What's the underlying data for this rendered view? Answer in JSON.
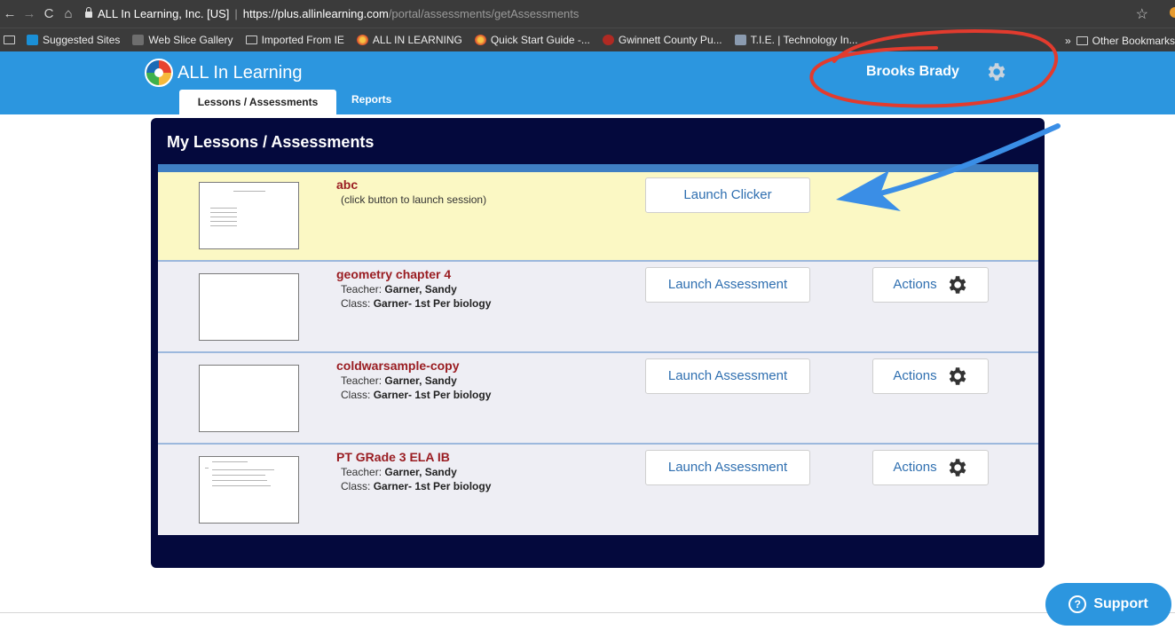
{
  "browser": {
    "site_identity": "ALL In Learning, Inc. [US]",
    "url_host": "https://plus.allinlearning.com",
    "url_path": "/portal/assessments/getAssessments",
    "bookmarks": [
      {
        "label": "Suggested Sites",
        "icon": "bing-icon"
      },
      {
        "label": "Web Slice Gallery",
        "icon": "web-slice-icon"
      },
      {
        "label": "Imported From IE",
        "icon": "folder-icon"
      },
      {
        "label": "ALL IN LEARNING",
        "icon": "all-in-learning-icon"
      },
      {
        "label": "Quick Start Guide -...",
        "icon": "all-in-learning-icon"
      },
      {
        "label": "Gwinnett County Pu...",
        "icon": "gwinnett-icon"
      },
      {
        "label": "T.I.E. | Technology In...",
        "icon": "tie-icon"
      }
    ],
    "overflow_label": "»",
    "other_bookmarks": "Other Bookmarks"
  },
  "header": {
    "brand": "ALL In Learning",
    "user_name": "Brooks Brady",
    "tabs": [
      {
        "label": "Lessons / Assessments",
        "active": true
      },
      {
        "label": "Reports",
        "active": false
      }
    ]
  },
  "panel": {
    "title": "My Lessons / Assessments",
    "rows": [
      {
        "title": "abc",
        "subtitle": "(click button to launch session)",
        "launch_label": "Launch Clicker",
        "highlight": true
      },
      {
        "title": "geometry chapter 4",
        "teacher_label": "Teacher:",
        "teacher": "Garner, Sandy",
        "class_label": "Class:",
        "class": "Garner- 1st Per biology",
        "launch_label": "Launch Assessment",
        "actions_label": "Actions"
      },
      {
        "title": "coldwarsample-copy",
        "teacher_label": "Teacher:",
        "teacher": "Garner, Sandy",
        "class_label": "Class:",
        "class": "Garner- 1st Per biology",
        "launch_label": "Launch Assessment",
        "actions_label": "Actions"
      },
      {
        "title": "PT GRade 3 ELA IB",
        "teacher_label": "Teacher:",
        "teacher": "Garner, Sandy",
        "class_label": "Class:",
        "class": "Garner- 1st Per biology",
        "launch_label": "Launch Assessment",
        "actions_label": "Actions"
      }
    ]
  },
  "support": {
    "label": "Support"
  },
  "colors": {
    "header_blue": "#2c96df",
    "panel_navy": "#04093d",
    "highlight_yellow": "#fbf8c4",
    "title_red": "#9a1d22",
    "annotation_red": "#e23b2e",
    "annotation_blue": "#3a8ee6"
  }
}
